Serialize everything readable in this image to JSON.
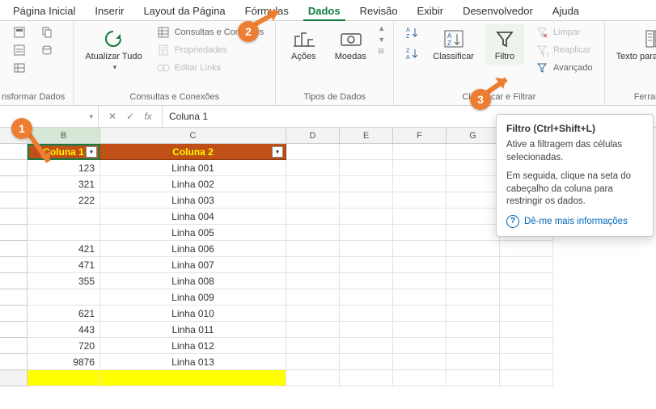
{
  "tabs": [
    "Página Inicial",
    "Inserir",
    "Layout da Página",
    "Fórmulas",
    "Dados",
    "Revisão",
    "Exibir",
    "Desenvolvedor",
    "Ajuda"
  ],
  "active_tab_index": 4,
  "ribbon": {
    "g1_label": "nsformar Dados",
    "atualizar": "Atualizar Tudo",
    "consultas": "Consultas e Conexões",
    "propriedades": "Propriedades",
    "editarlinks": "Editar Links",
    "g2_label": "Consultas e Conexões",
    "acoes": "Ações",
    "moedas": "Moedas",
    "g3_label": "Tipos de Dados",
    "classificar": "Classificar",
    "filtro": "Filtro",
    "limpar": "Limpar",
    "reaplicar": "Reaplicar",
    "avancado": "Avançado",
    "g4_label": "Classificar e Filtrar",
    "texto": "Texto para Colunas",
    "g5_label": "Ferrament"
  },
  "formula_bar": {
    "namebox": "",
    "formula": "Coluna 1"
  },
  "columns": [
    "B",
    "C",
    "D",
    "E",
    "F",
    "G"
  ],
  "headers": {
    "col1": "Coluna 1",
    "col2": "Coluna 2"
  },
  "chart_data": {
    "type": "table",
    "columns": [
      "Coluna 1",
      "Coluna 2"
    ],
    "rows": [
      {
        "c1": "123",
        "c2": "Linha 001"
      },
      {
        "c1": "321",
        "c2": "Linha 002"
      },
      {
        "c1": "222",
        "c2": "Linha 003"
      },
      {
        "c1": "",
        "c2": "Linha 004"
      },
      {
        "c1": "",
        "c2": "Linha 005"
      },
      {
        "c1": "421",
        "c2": "Linha 006"
      },
      {
        "c1": "471",
        "c2": "Linha 007"
      },
      {
        "c1": "355",
        "c2": "Linha 008"
      },
      {
        "c1": "",
        "c2": "Linha 009"
      },
      {
        "c1": "621",
        "c2": "Linha 010"
      },
      {
        "c1": "443",
        "c2": "Linha 011"
      },
      {
        "c1": "720",
        "c2": "Linha 012"
      },
      {
        "c1": "9876",
        "c2": "Linha 013"
      }
    ]
  },
  "tooltip": {
    "title": "Filtro (Ctrl+Shift+L)",
    "p1": "Ative a filtragem das células selecionadas.",
    "p2": "Em seguida, clique na seta do cabeçalho da coluna para restringir os dados.",
    "link": "Dê-me mais informações"
  },
  "callouts": {
    "n1": "1",
    "n2": "2",
    "n3": "3"
  }
}
